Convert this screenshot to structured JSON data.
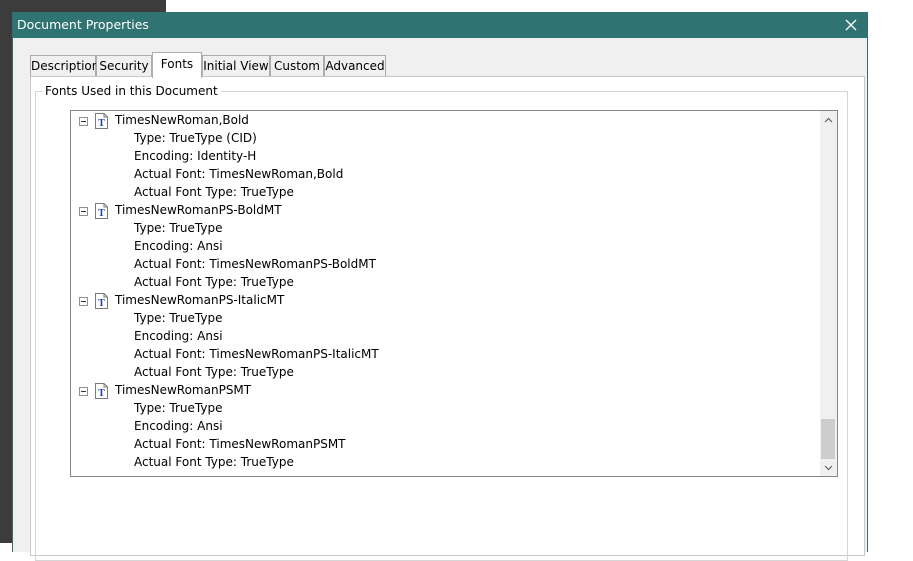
{
  "dialog": {
    "title": "Document Properties",
    "close_icon": "close-icon"
  },
  "tabs": [
    {
      "label": "Description",
      "active": false
    },
    {
      "label": "Security",
      "active": false
    },
    {
      "label": "Fonts",
      "active": true
    },
    {
      "label": "Initial View",
      "active": false
    },
    {
      "label": "Custom",
      "active": false
    },
    {
      "label": "Advanced",
      "active": false
    }
  ],
  "fonts_group": {
    "label": "Fonts Used in this Document",
    "fonts": [
      {
        "name": "TimesNewRoman,Bold",
        "props": [
          "Type: TrueType (CID)",
          "Encoding: Identity-H",
          "Actual Font: TimesNewRoman,Bold",
          "Actual Font Type: TrueType"
        ]
      },
      {
        "name": "TimesNewRomanPS-BoldMT",
        "props": [
          "Type: TrueType",
          "Encoding: Ansi",
          "Actual Font: TimesNewRomanPS-BoldMT",
          "Actual Font Type: TrueType"
        ]
      },
      {
        "name": "TimesNewRomanPS-ItalicMT",
        "props": [
          "Type: TrueType",
          "Encoding: Ansi",
          "Actual Font: TimesNewRomanPS-ItalicMT",
          "Actual Font Type: TrueType"
        ]
      },
      {
        "name": "TimesNewRomanPSMT",
        "props": [
          "Type: TrueType",
          "Encoding: Ansi",
          "Actual Font: TimesNewRomanPSMT",
          "Actual Font Type: TrueType"
        ]
      }
    ]
  },
  "scrollbar": {
    "position_fraction": 1.0,
    "up_icon": "chevron-up-icon",
    "down_icon": "chevron-down-icon"
  },
  "colors": {
    "titlebar": "#2f7373",
    "font_icon": "#1f3fa3"
  }
}
